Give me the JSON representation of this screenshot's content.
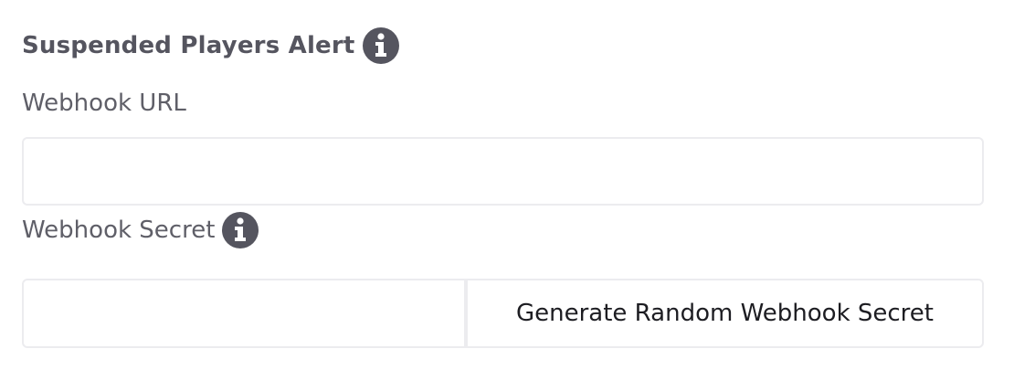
{
  "section": {
    "title": "Suspended Players Alert",
    "info_icon": "info-circle-icon"
  },
  "webhook_url": {
    "label": "Webhook URL",
    "value": "",
    "placeholder": ""
  },
  "webhook_secret": {
    "label": "Webhook Secret",
    "info_icon": "info-circle-icon",
    "value": "",
    "placeholder": ""
  },
  "generate_button": {
    "label": "Generate Random Webhook Secret"
  },
  "colors": {
    "text": "#55555f",
    "icon": "#55555f",
    "input_border": "#ececef",
    "button_text": "#1d1d22",
    "background": "#ffffff"
  }
}
